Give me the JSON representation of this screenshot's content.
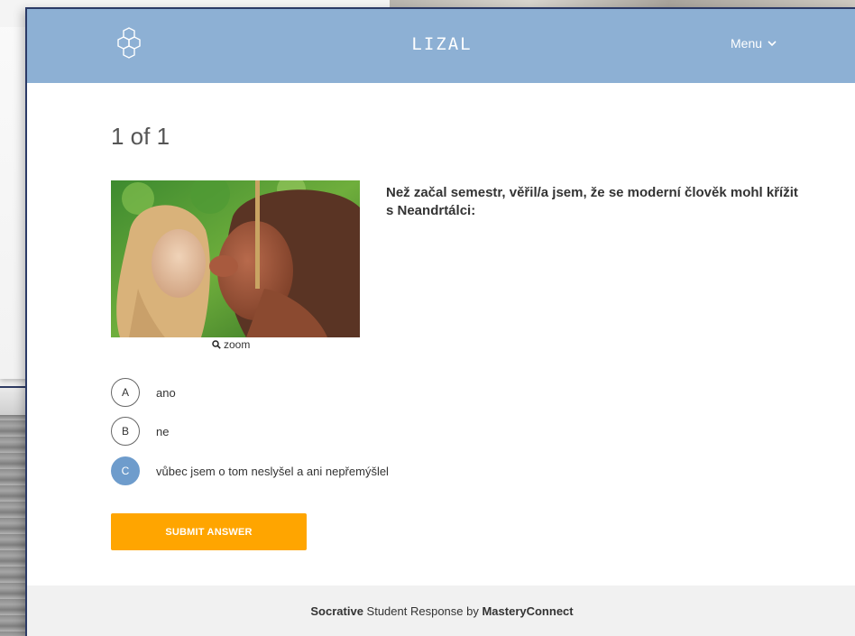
{
  "app": {
    "title": "LIZAL",
    "menu_label": "Menu"
  },
  "quiz": {
    "counter": "1 of 1",
    "question": "Než začal semestr, věřil/a jsem, že se moderní člověk mohl křížit s Neandrtálci:",
    "zoom_label": "zoom",
    "options": [
      {
        "letter": "A",
        "text": "ano",
        "selected": false
      },
      {
        "letter": "B",
        "text": "ne",
        "selected": false
      },
      {
        "letter": "C",
        "text": "vůbec jsem o tom neslyšel a ani nepřemýšlel",
        "selected": true
      }
    ],
    "submit_label": "SUBMIT ANSWER"
  },
  "footer": {
    "brand": "Socrative",
    "text": " Student Response by ",
    "company": "MasteryConnect"
  },
  "colors": {
    "header": "#8db0d4",
    "selected": "#6e9ccc",
    "submit": "#ffa500"
  },
  "icons": {
    "logo": "hexagon-molecule-icon",
    "menu": "chevron-down-icon",
    "zoom": "magnifier-icon"
  }
}
